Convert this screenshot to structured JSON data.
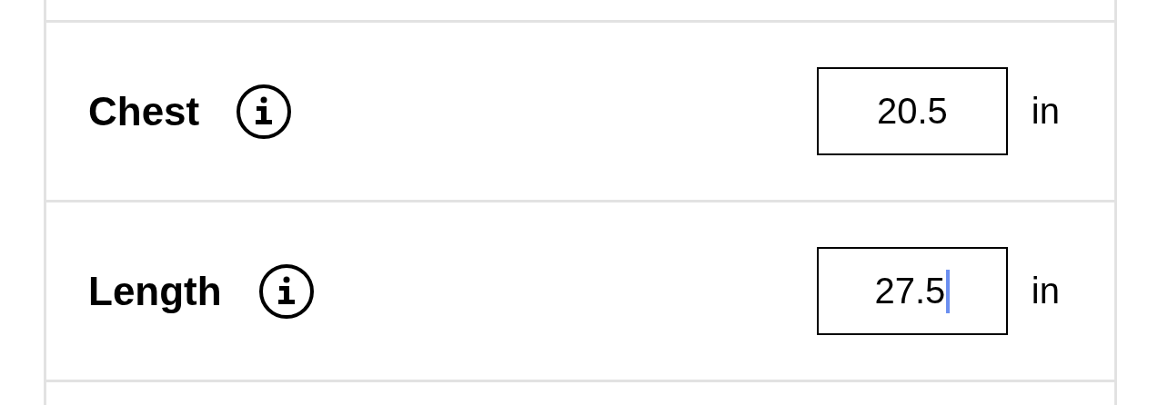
{
  "rows": [
    {
      "label": "Chest",
      "value": "20.5",
      "unit": "in",
      "focused": false
    },
    {
      "label": "Length",
      "value": "27.5",
      "unit": "in",
      "focused": true
    }
  ]
}
